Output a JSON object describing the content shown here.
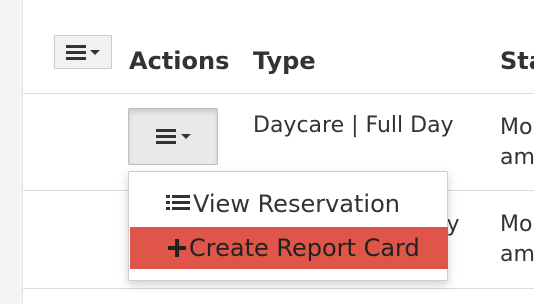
{
  "table": {
    "headers": {
      "actions": "Actions",
      "type": "Type",
      "status": "Sta"
    },
    "rows": [
      {
        "type": "Daycare | Full Day",
        "status_line1": "Mo",
        "status_line2": "am"
      },
      {
        "type": "ay",
        "status_line1": "Mo",
        "status_line2": "am"
      }
    ]
  },
  "dropdown": {
    "items": [
      {
        "label": "View Reservation",
        "icon": "list-icon"
      },
      {
        "label": "Create Report Card",
        "icon": "plus-icon",
        "highlighted": true
      }
    ]
  },
  "colors": {
    "highlight": "#e05549"
  }
}
